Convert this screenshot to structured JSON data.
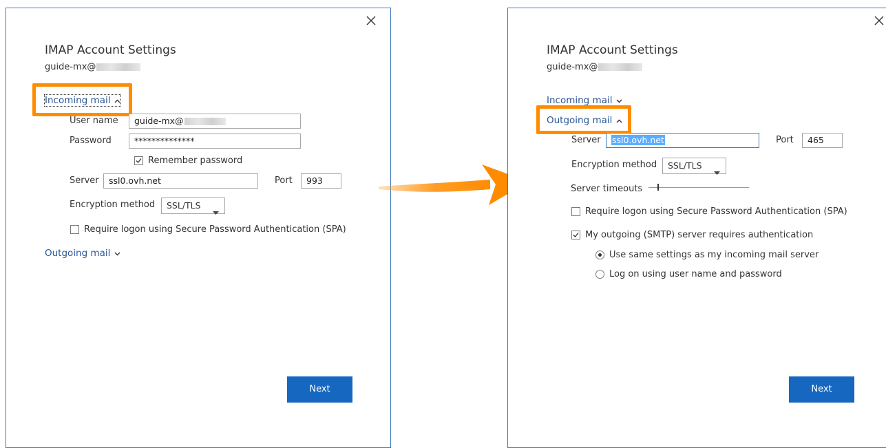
{
  "left_dialog": {
    "title": "IMAP Account Settings",
    "account": "guide-mx@",
    "incoming_label": "Incoming mail",
    "user_name_label": "User name",
    "user_name_value": "guide-mx@",
    "password_label": "Password",
    "password_value": "**************",
    "remember_password_label": "Remember password",
    "server_label": "Server",
    "server_value": "ssl0.ovh.net",
    "port_label": "Port",
    "port_value": "993",
    "encryption_label": "Encryption method",
    "encryption_value": "SSL/TLS",
    "spa_label": "Require logon using Secure Password Authentication (SPA)",
    "outgoing_label": "Outgoing mail",
    "next_label": "Next"
  },
  "right_dialog": {
    "title": "IMAP Account Settings",
    "account": "guide-mx@",
    "incoming_label": "Incoming mail",
    "outgoing_label": "Outgoing mail",
    "server_label": "Server",
    "server_value": "ssl0.ovh.net",
    "port_label": "Port",
    "port_value": "465",
    "encryption_label": "Encryption method",
    "encryption_value": "SSL/TLS",
    "timeouts_label": "Server timeouts",
    "spa_label": "Require logon using Secure Password Authentication (SPA)",
    "smtp_auth_label": "My outgoing (SMTP) server requires authentication",
    "same_settings_label": "Use same settings as my incoming mail server",
    "log_on_label": "Log on using user name and password",
    "next_label": "Next"
  },
  "state": {
    "left_remember_password": true,
    "left_spa": false,
    "right_spa": false,
    "right_smtp_auth": true,
    "right_auth_mode": "same-settings"
  },
  "colors": {
    "highlight": "#ff8c00",
    "primary_button": "#1567c0",
    "link": "#2a5796",
    "dialog_border": "#3d78c4"
  },
  "icons": {
    "close": "close-icon",
    "chevron_up": "chevron-up-icon",
    "chevron_down": "chevron-down-icon",
    "arrow": "arrow-right-icon"
  }
}
